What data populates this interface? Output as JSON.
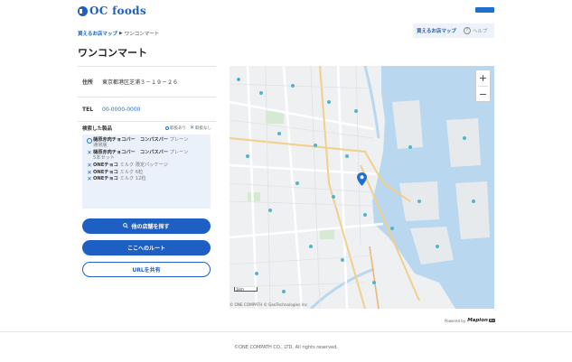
{
  "header": {
    "logo_text": "OC foods"
  },
  "breadcrumb": {
    "parent": "買えるお店マップ",
    "separator": "▶",
    "current": "ワンコンマート"
  },
  "toplinks": {
    "map_link": "買えるお店マップ",
    "help_icon": "?",
    "help_label": "ヘルプ"
  },
  "store": {
    "name": "ワンコンマート",
    "address_label": "住所",
    "address": "東京都港区芝浦３－１９－２６",
    "tel_label": "TEL",
    "tel": "00-0000-0000"
  },
  "search": {
    "label": "検索した製品",
    "legend_available": "取扱あり",
    "legend_unavailable": "取扱なし",
    "legend_x_symbol": "✕",
    "products": [
      {
        "status": "available",
        "bold": "樋原赤肉チョコバー　コンパスバー",
        "sub": " プレーン",
        "line2": "通常版"
      },
      {
        "status": "unavailable",
        "bold": "樋原赤肉チョコバー　コンパスバー",
        "sub": " プレーン",
        "line2": "5本セット"
      },
      {
        "status": "unavailable",
        "bold": "ONEチョコ",
        "sub": " ミルク 限定パッケージ",
        "line2": ""
      },
      {
        "status": "unavailable",
        "bold": "ONEチョコ",
        "sub": " ミルク 6粒",
        "line2": ""
      },
      {
        "status": "unavailable",
        "bold": "ONEチョコ",
        "sub": " ミルク 12粒",
        "line2": ""
      }
    ]
  },
  "buttons": {
    "other_stores": "他の店舗を探す",
    "route": "ここへのルート",
    "share_url": "URLを共有"
  },
  "map": {
    "zoom_in": "+",
    "zoom_out": "−",
    "scale": "1km",
    "copyright": "© ONE COMPATH © GeoTechnologies Inc.",
    "powered_by": "Powered by",
    "powered_brand": "Mapion",
    "powered_badge": "Biz",
    "colors": {
      "water": "#b9d8ef",
      "land": "#eef0f2",
      "pin": "#1f6fd0"
    }
  },
  "footer": {
    "copyright": "©ONE COMPATH CO., LTD. All rights reserved."
  }
}
